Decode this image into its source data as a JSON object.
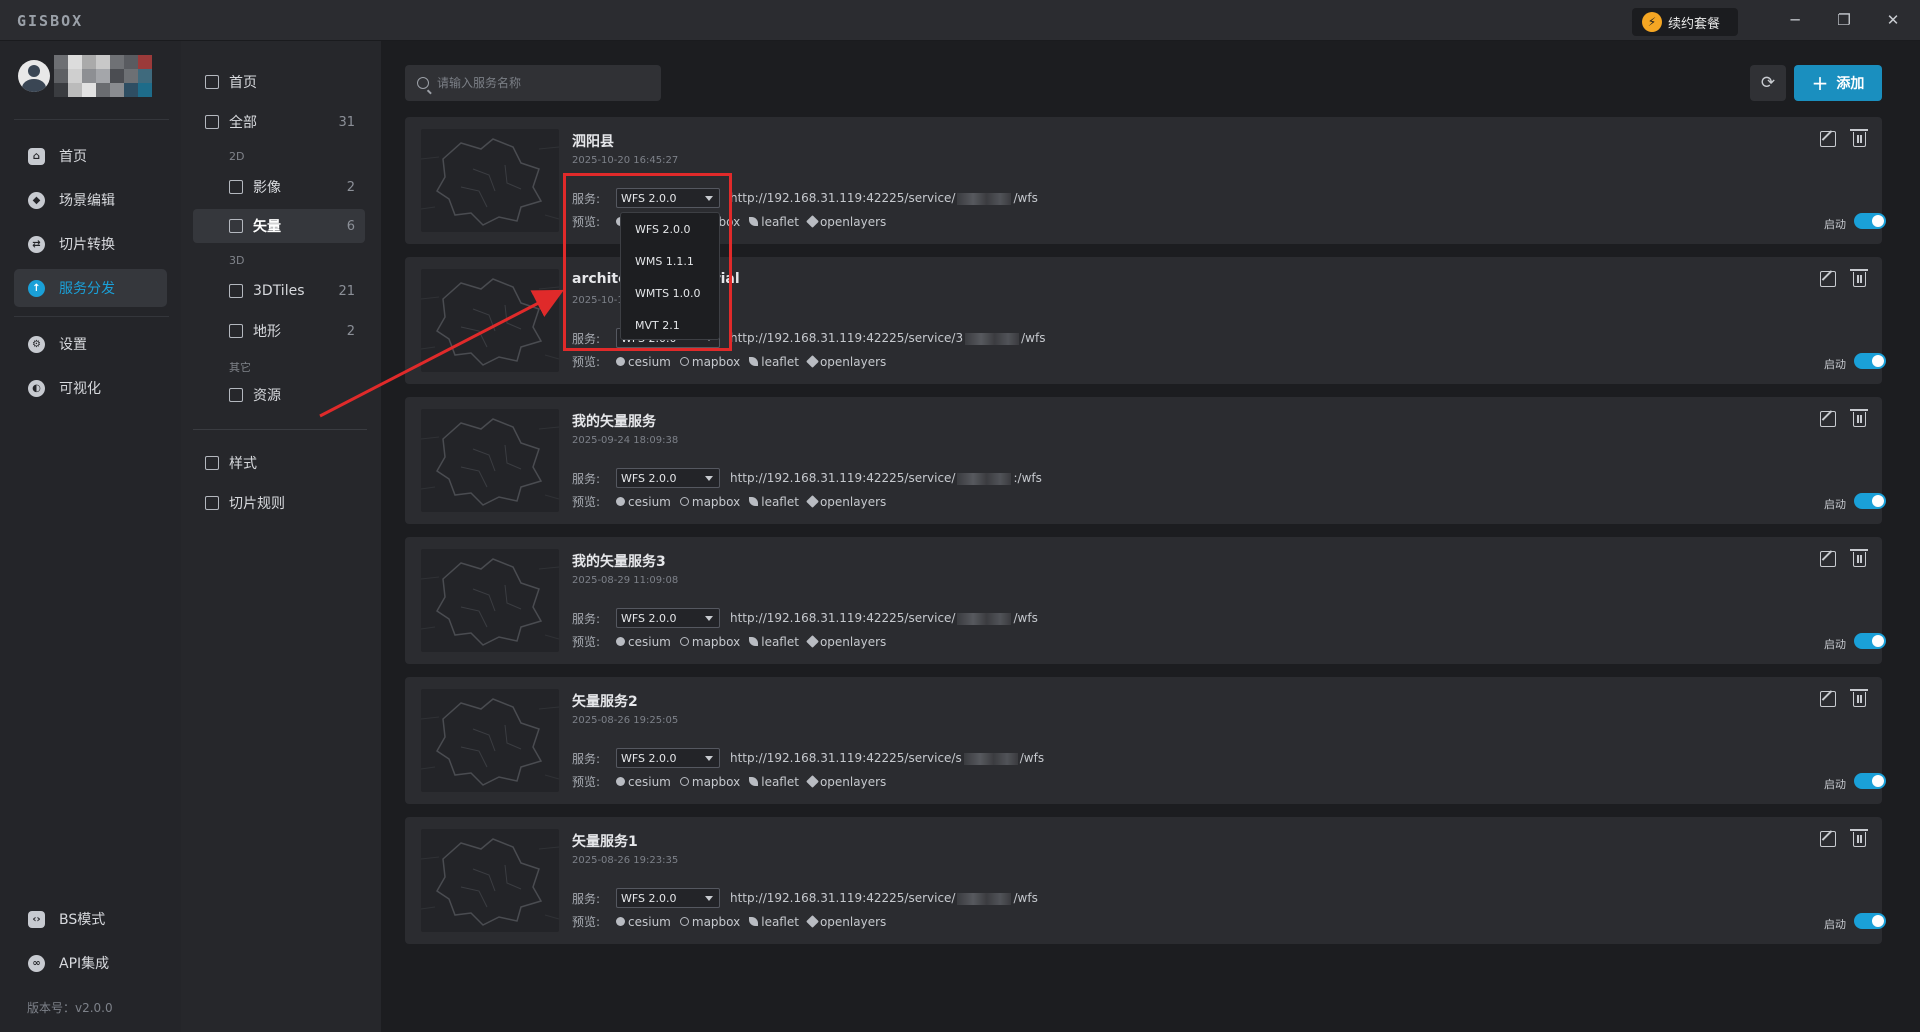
{
  "app": {
    "logo": "GISBOX",
    "renew_label": "续约套餐",
    "window_controls": [
      "minimize-icon",
      "restore-icon",
      "close-icon"
    ]
  },
  "nav": {
    "items": [
      {
        "label": "首页",
        "icon": "home-icon"
      },
      {
        "label": "场景编辑",
        "icon": "cube-icon"
      },
      {
        "label": "切片转换",
        "icon": "swap-icon"
      },
      {
        "label": "服务分发",
        "icon": "upload-icon",
        "active": true
      },
      {
        "label": "设置",
        "icon": "gear-icon"
      },
      {
        "label": "可视化",
        "icon": "chart-icon"
      }
    ],
    "bottom_items": [
      {
        "label": "BS模式",
        "icon": "code-icon"
      },
      {
        "label": "API集成",
        "icon": "link-icon"
      }
    ],
    "version": "版本号：v2.0.0"
  },
  "subnav": {
    "home": "首页",
    "all": {
      "label": "全部",
      "count": "31"
    },
    "group_2d": "2D",
    "imagery": {
      "label": "影像",
      "count": "2"
    },
    "vector": {
      "label": "矢量",
      "count": "6"
    },
    "group_3d": "3D",
    "tiles3d": {
      "label": "3DTiles",
      "count": "21"
    },
    "terrain": {
      "label": "地形",
      "count": "2"
    },
    "group_other": "其它",
    "resource": {
      "label": "资源"
    },
    "style": {
      "label": "样式"
    },
    "tile_rules": {
      "label": "切片规则"
    }
  },
  "toolbar": {
    "search_placeholder": "请输入服务名称",
    "add_label": "添加"
  },
  "labels": {
    "service": "服务:",
    "preview": "预览:",
    "enabled": "启动",
    "preview_targets": [
      "cesium",
      "mapbox",
      "leaflet",
      "openlayers"
    ]
  },
  "services": [
    {
      "title": "泗阳县",
      "date": "2025-10-20 16:45:27",
      "selected": "WFS 2.0.0",
      "url_prefix": "http://192.168.31.119:42225/service/",
      "url_suffix": "/wfs"
    },
    {
      "title": "architecture-imperial",
      "date": "2025-10-1",
      "selected": "WFS 2.0.0",
      "url_prefix": "http://192.168.31.119:42225/service/3",
      "url_suffix": "/wfs"
    },
    {
      "title": "我的矢量服务",
      "date": "2025-09-24 18:09:38",
      "selected": "WFS 2.0.0",
      "url_prefix": "http://192.168.31.119:42225/service/",
      "url_suffix": ":/wfs"
    },
    {
      "title": "我的矢量服务3",
      "date": "2025-08-29 11:09:08",
      "selected": "WFS 2.0.0",
      "url_prefix": "http://192.168.31.119:42225/service/",
      "url_suffix": "/wfs"
    },
    {
      "title": "矢量服务2",
      "date": "2025-08-26 19:25:05",
      "selected": "WFS 2.0.0",
      "url_prefix": "http://192.168.31.119:42225/service/s",
      "url_suffix": "/wfs"
    },
    {
      "title": "矢量服务1",
      "date": "2025-08-26 19:23:35",
      "selected": "WFS 2.0.0",
      "url_prefix": "http://192.168.31.119:42225/service/",
      "url_suffix": "/wfs"
    }
  ],
  "dropdown_options": [
    "WFS 2.0.0",
    "WMS 1.1.1",
    "WMTS 1.0.0",
    "MVT 2.1"
  ],
  "colors": {
    "accent": "#1aa0d8",
    "add_button": "#1a8fbf",
    "annotation_red": "#e02a2a",
    "renew_bolt": "#f5a623"
  }
}
